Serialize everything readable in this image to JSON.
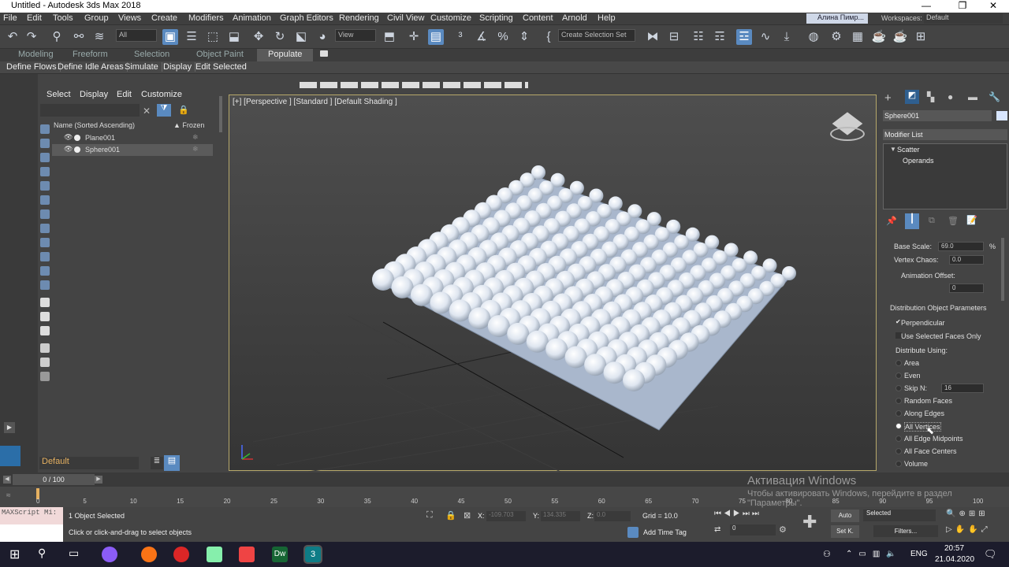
{
  "app": {
    "title": "Untitled - Autodesk 3ds Max 2018"
  },
  "menu": [
    "File",
    "Edit",
    "Tools",
    "Group",
    "Views",
    "Create",
    "Modifiers",
    "Animation",
    "Graph Editors",
    "Rendering",
    "Civil View",
    "Customize",
    "Scripting",
    "Content",
    "Arnold",
    "Help"
  ],
  "user": {
    "name": "Алина Пимр...",
    "workspaces_label": "Workspaces:",
    "workspace": "Default"
  },
  "toolbar": {
    "filter": "All",
    "refcoord": "View",
    "selset_placeholder": "Create Selection Set"
  },
  "ribbon": {
    "tabs": [
      "Modeling",
      "Freeform",
      "Selection",
      "Object Paint",
      "Populate"
    ],
    "active": "Populate"
  },
  "ribbon2": [
    "Define Flows",
    "Define Idle Areas",
    "Simulate",
    "Display",
    "Edit Selected"
  ],
  "explorer": {
    "tabs": [
      "Select",
      "Display",
      "Edit",
      "Customize"
    ],
    "col_name": "Name (Sorted Ascending)",
    "col_frozen": "▲ Frozen",
    "items": [
      "Plane001",
      "Sphere001"
    ],
    "layer": "Default"
  },
  "viewport": {
    "label": "[+] [Perspective ] [Standard ] [Default Shading ]"
  },
  "rightpanel": {
    "object_name": "Sphere001",
    "modifier_list": "Modifier List",
    "stack": [
      "Scatter",
      "Operands"
    ],
    "base_scale_label": "Base Scale:",
    "base_scale": "69.0",
    "pct": "%",
    "vertex_chaos_label": "Vertex Chaos:",
    "vertex_chaos": "0.0",
    "anim_offset_label": "Animation Offset:",
    "anim_offset": "0",
    "dist_header": "Distribution Object Parameters",
    "perpendicular": "Perpendicular",
    "use_selected": "Use Selected Faces Only",
    "distribute_using": "Distribute Using:",
    "options": [
      "Area",
      "Even",
      "Skip N:",
      "Random Faces",
      "Along Edges",
      "All Vertices",
      "All Edge Midpoints",
      "All Face Centers",
      "Volume"
    ],
    "skip_n": "16",
    "selected_option": "All Vertices"
  },
  "timeslider": {
    "frame": "0 / 100"
  },
  "ticks": [
    "0",
    "5",
    "10",
    "15",
    "20",
    "25",
    "30",
    "35",
    "40",
    "45",
    "50",
    "55",
    "60",
    "65",
    "70",
    "75",
    "80",
    "85",
    "90",
    "95",
    "100"
  ],
  "status": {
    "maxscript": "MAXScript Mi:",
    "selected": "1 Object Selected",
    "hint": "Click or click-and-drag to select objects",
    "x_label": "X:",
    "x": "-109.703",
    "y_label": "Y:",
    "y": "134.335",
    "z_label": "Z:",
    "z": "0.0",
    "grid": "Grid = 10.0",
    "add_time_tag": "Add Time Tag",
    "auto": "Auto",
    "set_k": "Set K.",
    "selected_dd": "Selected",
    "filters": "Filters...",
    "frame_field": "0"
  },
  "watermark": {
    "line1": "Активация Windows",
    "line2": "Чтобы активировать Windows, перейдите в раздел",
    "line3": "\"Параметры\"."
  },
  "taskbar": {
    "lang": "ENG",
    "time": "20:57",
    "date": "21.04.2020"
  }
}
